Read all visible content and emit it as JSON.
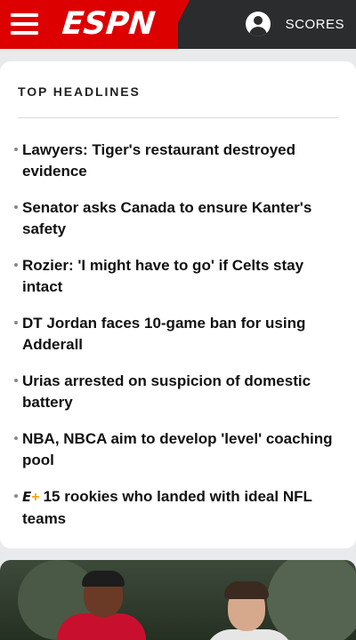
{
  "header": {
    "logo_text": "ESPN",
    "scores_label": "SCORES",
    "icons": [
      "hamburger-menu-icon",
      "user-profile-icon"
    ],
    "colors": {
      "brand_red": "#dd0000",
      "bar_dark": "#2b2c2d"
    }
  },
  "top_headlines": {
    "title": "TOP HEADLINES",
    "items": [
      {
        "text": "Lawyers: Tiger's restaurant destroyed evidence"
      },
      {
        "text": "Senator asks Canada to ensure Kanter's safety"
      },
      {
        "text": "Rozier: 'I might have to go' if Celts stay intact"
      },
      {
        "text": "DT Jordan faces 10-game ban for using Adderall"
      },
      {
        "text": "Urias arrested on suspicion of domestic battery"
      },
      {
        "text": "NBA, NBCA aim to develop 'level' coaching pool"
      },
      {
        "text": "15 rookies who landed with ideal NFL teams",
        "badge": {
          "e": "E",
          "plus": "+"
        }
      }
    ]
  }
}
